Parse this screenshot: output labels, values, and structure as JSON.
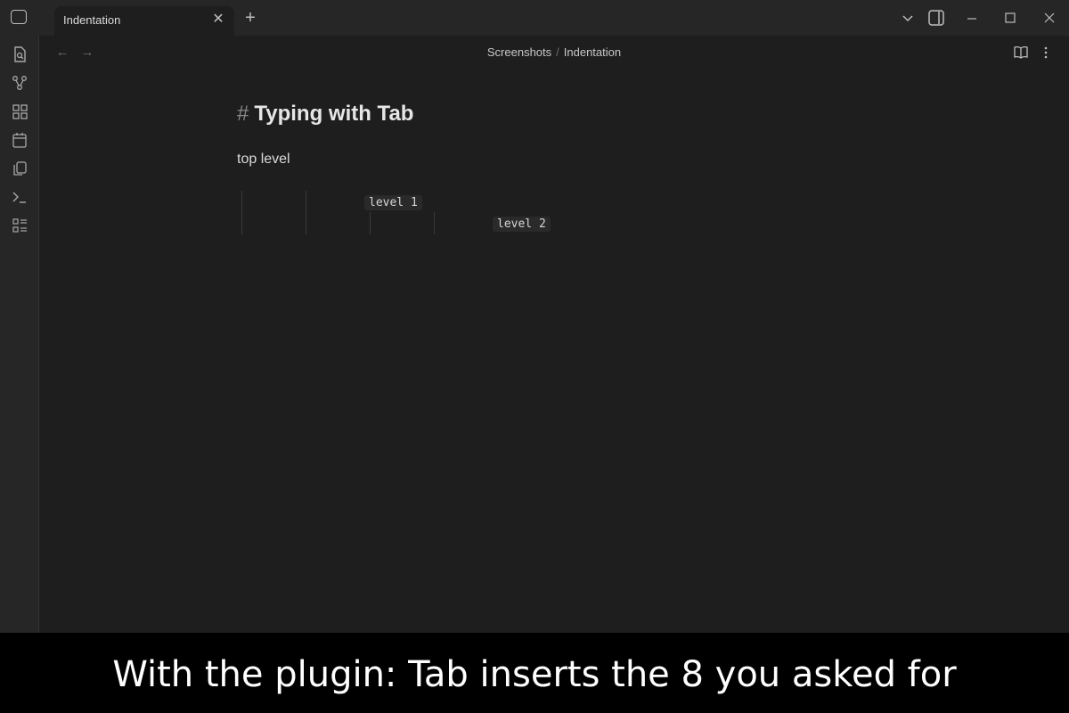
{
  "window": {
    "tab_title": "Indentation",
    "tab_close_icon": "close-icon",
    "new_tab_icon": "plus-icon"
  },
  "ribbon": {
    "icons": [
      "file-search-icon",
      "graph-icon",
      "canvas-icon",
      "calendar-icon",
      "copy-icon",
      "terminal-icon",
      "list-icon"
    ]
  },
  "header": {
    "breadcrumb": [
      "Screenshots",
      "Indentation"
    ],
    "separator": "/"
  },
  "editor": {
    "heading_marker": "#",
    "heading": "Typing with Tab",
    "paragraph": "top level",
    "code_level_1": "level 1",
    "code_level_2": "level 2"
  },
  "caption": "With the plugin: Tab inserts the 8 you asked for",
  "colors": {
    "background": "#1e1e1e",
    "chrome": "#262626",
    "caption_bg": "#000000"
  }
}
